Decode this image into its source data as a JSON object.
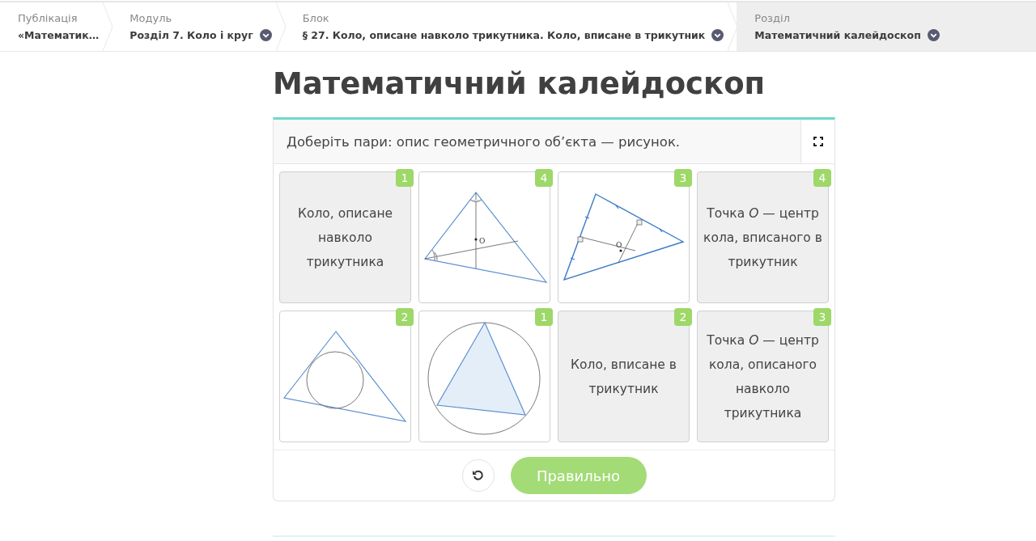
{
  "breadcrumbs": [
    {
      "label": "Публікація",
      "value": "«Математик…",
      "dropdown": false,
      "selected": false
    },
    {
      "label": "Модуль",
      "value": "Розділ 7. Коло і круг",
      "dropdown": true,
      "selected": false
    },
    {
      "label": "Блок",
      "value": "§ 27. Коло, описане навколо трикутника. Коло, вписане в трикутник",
      "dropdown": true,
      "selected": false
    },
    {
      "label": "Розділ",
      "value": "Математичний калейдоскоп",
      "dropdown": true,
      "selected": true
    }
  ],
  "title": "Математичний калейдоскоп",
  "task": {
    "prompt": "Доберіть пари: опис геометричного об’єкта — рисунок.",
    "cards": [
      {
        "kind": "text",
        "text": "Коло, описане навколо трикутника",
        "badge": "1"
      },
      {
        "kind": "bisectors",
        "label": "O",
        "badge": "4"
      },
      {
        "kind": "perpendiculars",
        "label": "O",
        "badge": "3"
      },
      {
        "kind": "text",
        "text": "Точка *O* — центр кола, вписаного в трикутник",
        "badge": "4"
      },
      {
        "kind": "incircle",
        "badge": "2"
      },
      {
        "kind": "circumcircle",
        "badge": "1"
      },
      {
        "kind": "text",
        "text": "Коло, вписане в трикутник",
        "badge": "2"
      },
      {
        "kind": "text",
        "text": "Точка *O* — центр кола, описаного навколо трикутника",
        "badge": "3"
      }
    ],
    "check_button": "Правильно"
  }
}
